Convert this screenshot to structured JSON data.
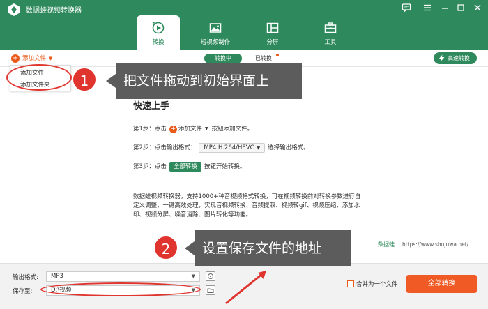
{
  "app": {
    "title": "数据蛙视频转换器"
  },
  "main_tabs": [
    {
      "label": "转换",
      "icon": "convert-icon",
      "active": true
    },
    {
      "label": "短视频制作",
      "icon": "short-video-icon",
      "active": false
    },
    {
      "label": "分屏",
      "icon": "split-screen-icon",
      "active": false
    },
    {
      "label": "工具",
      "icon": "toolbox-icon",
      "active": false
    }
  ],
  "toolbar": {
    "add_file": "添加文件",
    "tab_converting": "转换中",
    "tab_converted": "已转换",
    "fast_convert": "高速转换"
  },
  "add_menu": {
    "items": [
      "添加文件",
      "添加文件夹"
    ]
  },
  "quick_start": {
    "title": "快速上手",
    "step1_prefix": "第1步：点击",
    "step1_chip": "添加文件",
    "step1_suffix": "按钮添加文件。",
    "step2_prefix": "第2步：点击输出格式：",
    "step2_chip": "MP4 H.264/HEVC",
    "step2_suffix": "选择输出格式。",
    "step3_prefix": "第3步：点击",
    "step3_chip": "全部转换",
    "step3_suffix": "按钮开始转换。",
    "description": "数据蛙视频转换器，支持1000+种音视频格式转换，可在视频转换前对转换参数进行自定义调整，一键高效处理，实现音视频转换、音频提取、视频转gif、视频压缩、添加水印、视频分屏、噪音消除、图片转化等功能。"
  },
  "watermark": {
    "brand": "数据蛙",
    "url": "https://www.shujuwa.net/"
  },
  "bottom": {
    "output_format_label": "输出格式:",
    "output_format_value": "MP3",
    "save_to_label": "保存至:",
    "save_to_value": "D:\\视频",
    "merge_label": "合并为一个文件",
    "convert_all": "全部转换"
  },
  "annotations": [
    {
      "number": "1",
      "text": "把文件拖动到初始界面上"
    },
    {
      "number": "2",
      "text": "设置保存文件的地址"
    }
  ],
  "colors": {
    "brand": "#2e8a5c",
    "accent": "#f05a24",
    "marker": "#e0342f",
    "callout": "#5c5c5c"
  }
}
